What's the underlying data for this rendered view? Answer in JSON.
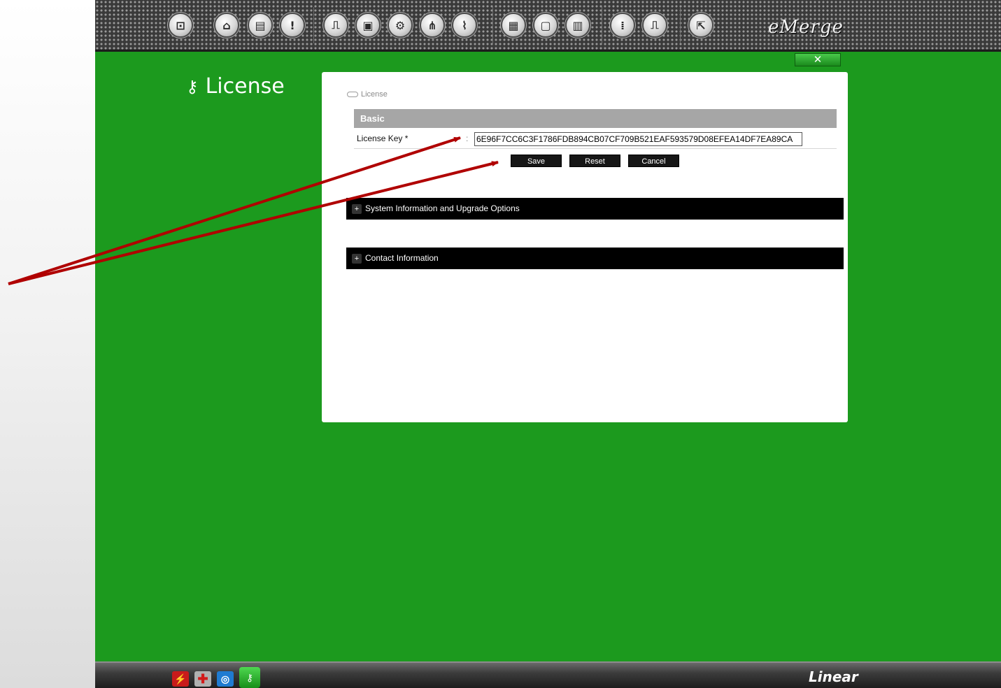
{
  "toolbar": {
    "buttons": [
      {
        "name": "monitor-icon",
        "glyph": "⊡"
      },
      {
        "name": "person-icon",
        "glyph": "⌂"
      },
      {
        "name": "id-card-icon",
        "glyph": "▤"
      },
      {
        "name": "alert-icon",
        "glyph": "!"
      },
      {
        "name": "door-setup-icon",
        "glyph": "⎍"
      },
      {
        "name": "photo-setup-icon",
        "glyph": "▣"
      },
      {
        "name": "gears-icon",
        "glyph": "⚙"
      },
      {
        "name": "network-icon",
        "glyph": "⋔"
      },
      {
        "name": "wiring-icon",
        "glyph": "⌇"
      },
      {
        "name": "save-icon",
        "glyph": "▦"
      },
      {
        "name": "document-icon",
        "glyph": "▢"
      },
      {
        "name": "reports-icon",
        "glyph": "▥"
      },
      {
        "name": "keypad-icon",
        "glyph": "⁞"
      },
      {
        "name": "door-icon",
        "glyph": "⎍"
      },
      {
        "name": "exit-icon",
        "glyph": "⇱"
      }
    ],
    "brand": "eMerge"
  },
  "close_button": {
    "label": "✕"
  },
  "page_heading": {
    "icon": "⚷",
    "title": "License"
  },
  "breadcrumb": {
    "label": "License"
  },
  "basic_section": {
    "title": "Basic"
  },
  "license_form": {
    "key_label": "License Key *",
    "colon": ":",
    "key_value": "6E96F7CC6C3F1786FDB894CB07CF709B521EAF593579D08EFEA14DF7EA89CA"
  },
  "buttons": {
    "save": "Save",
    "reset": "Reset",
    "cancel": "Cancel"
  },
  "sections": {
    "system_info": {
      "title": "System Information and Upgrade Options",
      "expander": "+"
    },
    "contact_info": {
      "title": "Contact Information",
      "expander": "+"
    }
  },
  "bottom_bar": {
    "icons": {
      "wand": "⚡",
      "health": "✚",
      "nav": "◎",
      "license": "⚷"
    },
    "logo": "Linear"
  },
  "annotation_color": "#b00000"
}
